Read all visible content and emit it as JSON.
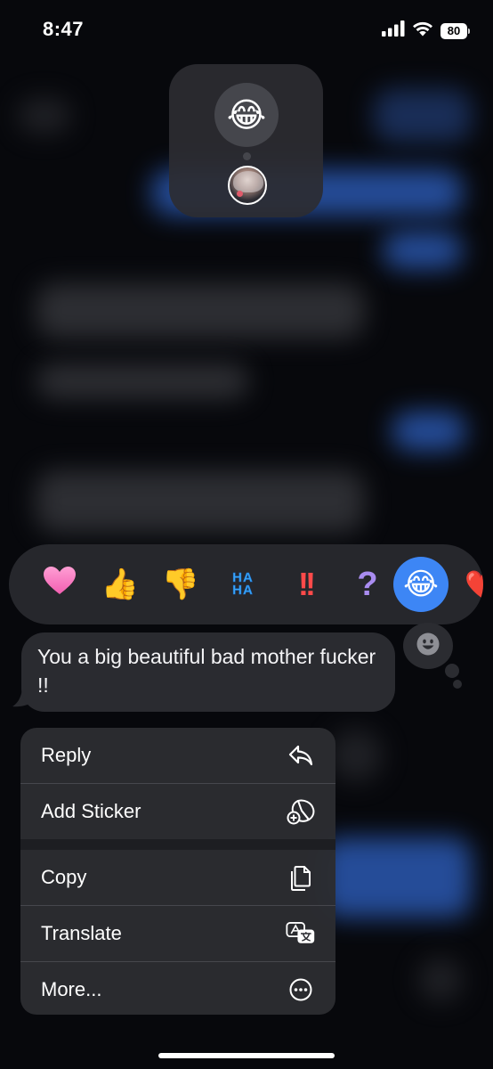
{
  "status_bar": {
    "time": "8:47",
    "battery_level": "80",
    "signal_bars": 4,
    "wifi": true
  },
  "reaction_detail": {
    "emoji": "😂",
    "emoji_name": "face-with-tears-of-joy",
    "reactor_avatar": "contact-avatar"
  },
  "tapbacks": [
    {
      "id": "heart",
      "icon": "heart-icon",
      "glyph": "🩷",
      "selected": false
    },
    {
      "id": "thumbs-up",
      "icon": "thumbs-up-icon",
      "glyph": "👍",
      "selected": false
    },
    {
      "id": "thumbs-down",
      "icon": "thumbs-down-icon",
      "glyph": "👎",
      "selected": false
    },
    {
      "id": "haha",
      "icon": "haha-icon",
      "glyph": "HA\nHA",
      "selected": false
    },
    {
      "id": "emphasize",
      "icon": "double-exclamation-icon",
      "glyph": "!!",
      "selected": false
    },
    {
      "id": "question",
      "icon": "question-mark-icon",
      "glyph": "?",
      "selected": false
    },
    {
      "id": "laugh",
      "icon": "tears-of-joy-icon",
      "glyph": "😂",
      "selected": true
    },
    {
      "id": "partial",
      "icon": "heart-partial-icon",
      "glyph": "❤️",
      "selected": false
    }
  ],
  "message": {
    "text": "You a big beautiful bad mother fucker !!"
  },
  "context_menu": {
    "items": [
      {
        "label": "Reply",
        "icon": "reply-arrow-icon"
      },
      {
        "label": "Add Sticker",
        "icon": "add-sticker-icon"
      },
      {
        "label": "Copy",
        "icon": "copy-icon"
      },
      {
        "label": "Translate",
        "icon": "translate-icon"
      },
      {
        "label": "More...",
        "icon": "more-ellipsis-icon"
      }
    ]
  },
  "colors": {
    "accent_blue": "#3d86f5",
    "menu_background": "#2b2c31",
    "bubble_gray": "#2a2b30"
  }
}
